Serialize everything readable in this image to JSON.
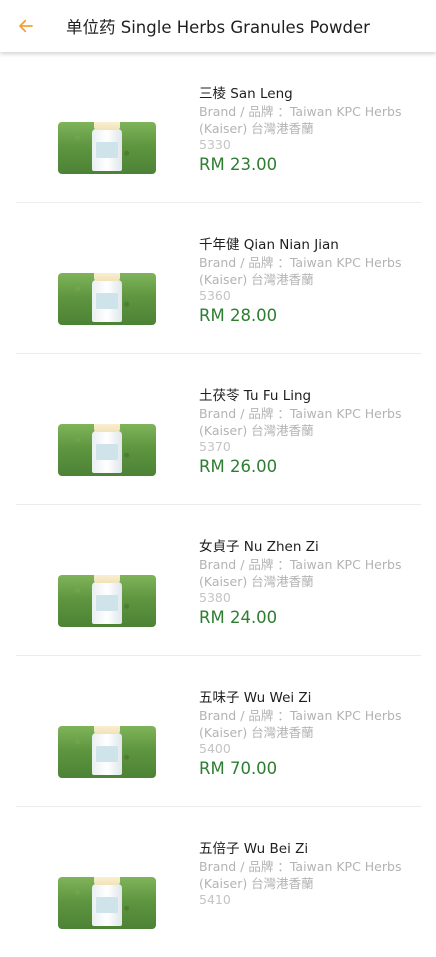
{
  "header": {
    "back_icon": "arrow-left-icon",
    "title": "单位药 Single Herbs Granules Powder",
    "accent_color": "#f0a23c"
  },
  "products": [
    {
      "name": "三棱 San Leng",
      "brand": "Brand / 品牌 ：Taiwan KPC Herbs (Kaiser) 台灣港香蘭",
      "code": "5330",
      "price": "RM 23.00"
    },
    {
      "name": "千年健 Qian Nian Jian",
      "brand": "Brand / 品牌 ：Taiwan KPC Herbs (Kaiser) 台灣港香蘭",
      "code": "5360",
      "price": "RM 28.00"
    },
    {
      "name": "土茯苓 Tu Fu Ling",
      "brand": "Brand / 品牌 ：Taiwan KPC Herbs (Kaiser) 台灣港香蘭",
      "code": "5370",
      "price": "RM 26.00"
    },
    {
      "name": "女貞子 Nu Zhen Zi",
      "brand": "Brand / 品牌 ：Taiwan KPC Herbs (Kaiser) 台灣港香蘭",
      "code": "5380",
      "price": "RM 24.00"
    },
    {
      "name": "五味子 Wu Wei Zi",
      "brand": "Brand / 品牌 ：Taiwan KPC Herbs (Kaiser) 台灣港香蘭",
      "code": "5400",
      "price": "RM 70.00"
    },
    {
      "name": "五倍子 Wu Bei Zi",
      "brand": "Brand / 品牌 ：Taiwan KPC Herbs (Kaiser) 台灣港香蘭",
      "code": "5410",
      "price": ""
    }
  ],
  "colors": {
    "price": "#2e7d32",
    "muted": "#b3b3b3"
  }
}
